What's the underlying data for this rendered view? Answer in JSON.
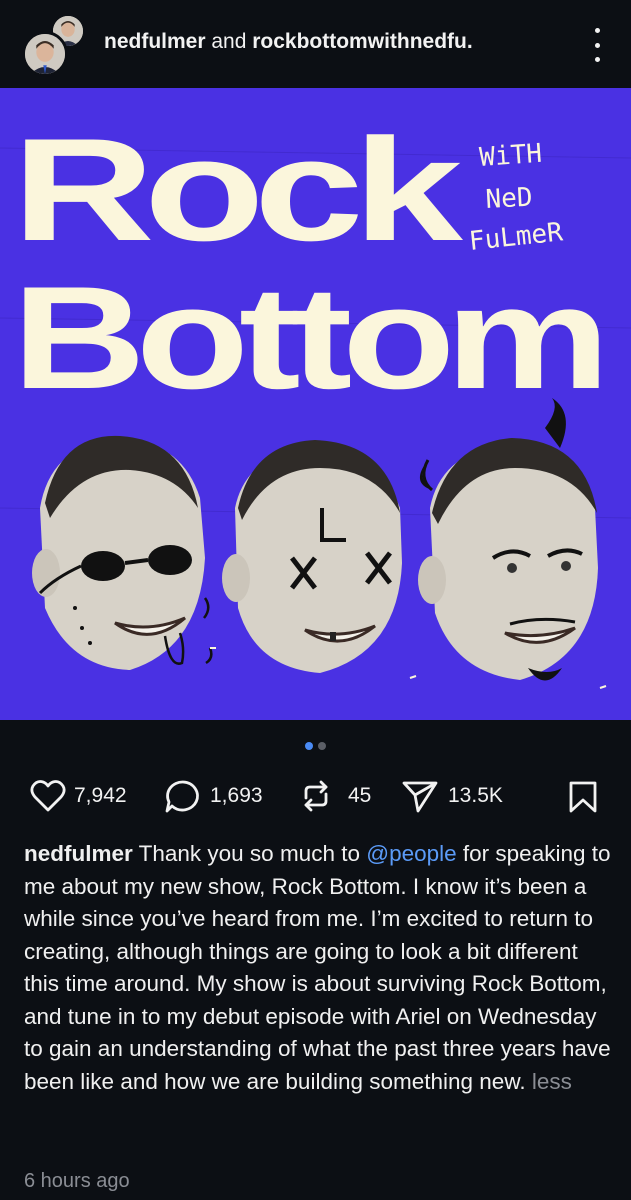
{
  "header": {
    "username_primary": "nedfulmer",
    "connector": " and ",
    "username_secondary": "rockbottomwithnedfu."
  },
  "artwork": {
    "title_line1": "Rock",
    "title_line2": "Bottom",
    "handwritten_1": "WiTH",
    "handwritten_2": "NeD",
    "handwritten_3": "FuLmeR",
    "bg_color": "#4a31e3",
    "title_color": "#fbf6dc"
  },
  "carousel": {
    "total": 2,
    "active_index": 1
  },
  "actions": {
    "likes": "7,942",
    "comments": "1,693",
    "reposts": "45",
    "shares": "13.5K"
  },
  "caption": {
    "username": "nedfulmer",
    "text_before_mention": " Thank you so much to ",
    "mention": "@people",
    "text_after_mention": " for speaking to me about my new show, Rock Bottom. I know it’s been a while since you’ve heard from me. I’m excited to return to creating, although things are going to look a bit different this time around. My show is about surviving Rock Bottom, and tune in to my debut episode with Ariel on Wednesday to gain an understanding of what the past three years have been like and how we are building something new. ",
    "less_label": "less"
  },
  "timestamp": "6 hours ago",
  "colors": {
    "accent": "#4a8af4",
    "mention": "#5b9bf8",
    "muted": "#8a8d94"
  }
}
